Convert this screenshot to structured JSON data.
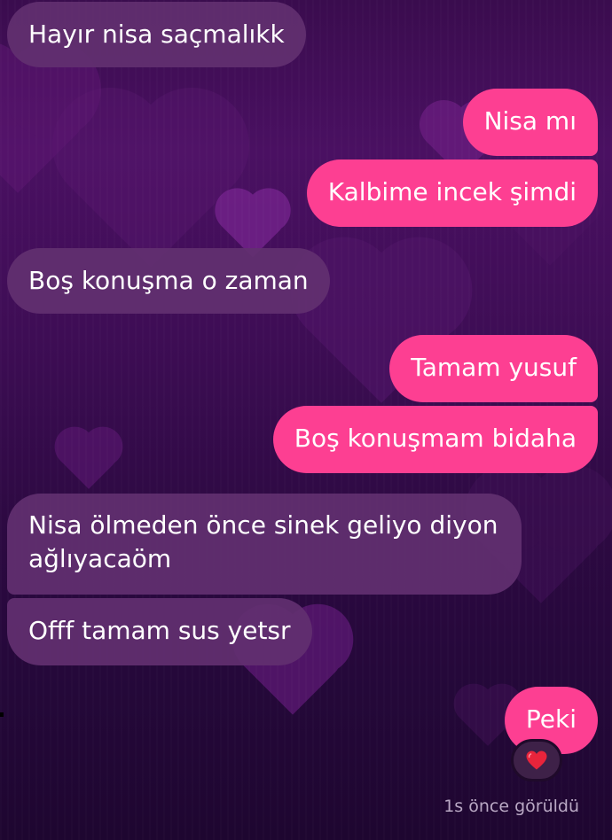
{
  "chat": {
    "messages": [
      {
        "direction": "incoming",
        "text": "Hayır nisa saçmalıkk"
      },
      {
        "direction": "outgoing",
        "text": "Nisa mı"
      },
      {
        "direction": "outgoing",
        "text": "Kalbime incek şimdi"
      },
      {
        "direction": "incoming",
        "text": "Boş konuşma o zaman"
      },
      {
        "direction": "outgoing",
        "text": "Tamam yusuf"
      },
      {
        "direction": "outgoing",
        "text": "Boş konuşmam bidaha"
      },
      {
        "direction": "incoming",
        "text": "Nisa ölmeden önce sinek geliyo diyon ağlıyacaöm"
      },
      {
        "direction": "incoming",
        "text": "Offf tamam sus yetsr"
      },
      {
        "direction": "outgoing",
        "text": "Peki"
      }
    ],
    "last_reaction": {
      "emoji": "heart",
      "icon": "red-heart-icon",
      "color": "#e8243b"
    },
    "seen_status": "1s önce görüldü"
  },
  "theme": {
    "outgoing_bubble": "#fd3f92",
    "incoming_bubble": "#623070",
    "background": "#3a0c4e"
  }
}
